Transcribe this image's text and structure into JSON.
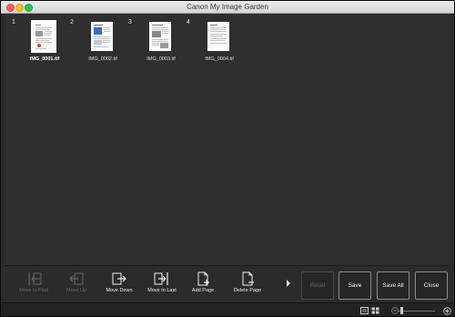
{
  "window": {
    "title": "Canon My Image Garden"
  },
  "thumbnails": [
    {
      "number": "1",
      "filename": "IMG_0001.tif",
      "selected": true
    },
    {
      "number": "2",
      "filename": "IMG_0002.tif",
      "selected": false
    },
    {
      "number": "3",
      "filename": "IMG_0003.tif",
      "selected": false
    },
    {
      "number": "4",
      "filename": "IMG_0004.tif",
      "selected": false
    }
  ],
  "toolbar": {
    "move_to_first": "Move to First",
    "move_up": "Move Up",
    "move_down": "Move Down",
    "move_to_last": "Move to Last",
    "add_page": "Add Page",
    "delete_page": "Delete Page",
    "reset": "Reset",
    "save": "Save",
    "save_all": "Save All",
    "close": "Close"
  },
  "icons": {
    "more": "chevron-right-icon",
    "view_single": "single-view-icon",
    "view_grid": "grid-view-icon",
    "zoom_out": "zoom-out-icon",
    "zoom_in": "zoom-in-icon"
  },
  "colors": {
    "background": "#2b2b2b",
    "content": "#2f2f2f",
    "text": "#ececec",
    "disabled_text": "#6a6a6a"
  }
}
